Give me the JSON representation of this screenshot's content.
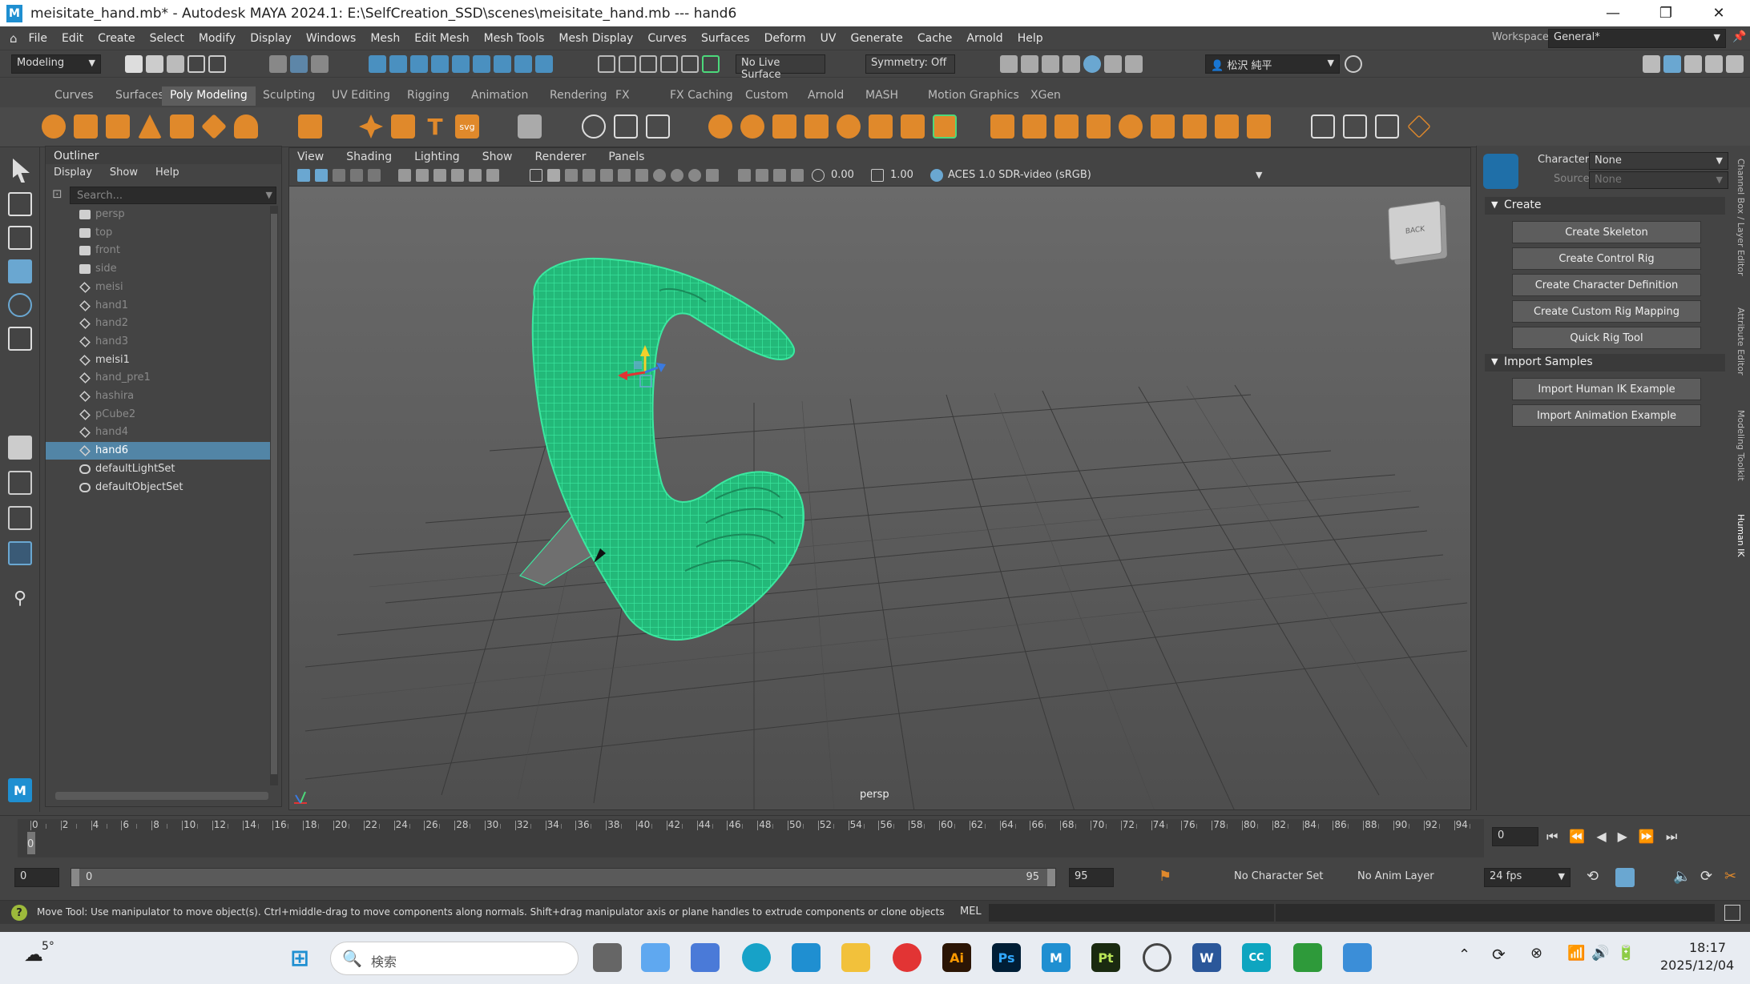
{
  "window": {
    "title": "meisitate_hand.mb* - Autodesk MAYA 2024.1: E:\\SelfCreation_SSD\\scenes\\meisitate_hand.mb   ---   hand6",
    "logo": "M"
  },
  "menus": [
    "File",
    "Edit",
    "Create",
    "Select",
    "Modify",
    "Display",
    "Windows",
    "Mesh",
    "Edit Mesh",
    "Mesh Tools",
    "Mesh Display",
    "Curves",
    "Surfaces",
    "Deform",
    "UV",
    "Generate",
    "Cache",
    "Arnold",
    "Help"
  ],
  "workspace": {
    "label": "Workspace:",
    "value": "General*"
  },
  "status": {
    "mode": "Modeling",
    "live_surface": "No Live Surface",
    "symmetry": "Symmetry: Off",
    "user": "松沢 純平"
  },
  "shelf_tabs": [
    "Curves",
    "Surfaces",
    "Poly Modeling",
    "Sculpting",
    "UV Editing",
    "Rigging",
    "Animation",
    "Rendering",
    "FX",
    "FX Caching",
    "Custom",
    "Arnold",
    "MASH",
    "Motion Graphics",
    "XGen"
  ],
  "shelf_active": "Poly Modeling",
  "outliner": {
    "title": "Outliner",
    "menu": [
      "Display",
      "Show",
      "Help"
    ],
    "search_placeholder": "Search...",
    "items": [
      {
        "name": "persp",
        "type": "camera",
        "dim": true
      },
      {
        "name": "top",
        "type": "camera",
        "dim": true
      },
      {
        "name": "front",
        "type": "camera",
        "dim": true
      },
      {
        "name": "side",
        "type": "camera",
        "dim": true
      },
      {
        "name": "meisi",
        "type": "mesh",
        "dim": true
      },
      {
        "name": "hand1",
        "type": "mesh",
        "dim": true
      },
      {
        "name": "hand2",
        "type": "mesh",
        "dim": true
      },
      {
        "name": "hand3",
        "type": "mesh",
        "dim": true
      },
      {
        "name": "meisi1",
        "type": "mesh",
        "dim": false
      },
      {
        "name": "hand_pre1",
        "type": "mesh",
        "dim": true
      },
      {
        "name": "hashira",
        "type": "mesh",
        "dim": true
      },
      {
        "name": "pCube2",
        "type": "mesh",
        "dim": true
      },
      {
        "name": "hand4",
        "type": "mesh",
        "dim": true
      },
      {
        "name": "hand6",
        "type": "mesh",
        "dim": false,
        "selected": true
      },
      {
        "name": "defaultLightSet",
        "type": "set",
        "dim": false
      },
      {
        "name": "defaultObjectSet",
        "type": "set",
        "dim": false
      }
    ]
  },
  "viewport": {
    "menu": [
      "View",
      "Shading",
      "Lighting",
      "Show",
      "Renderer",
      "Panels"
    ],
    "exposure": "0.00",
    "gamma": "1.00",
    "colorspace": "ACES 1.0 SDR-video (sRGB)",
    "camera_label": "persp",
    "viewcube_label": "BACK",
    "wire_color": "#3be8a0"
  },
  "hik": {
    "character_label": "Character:",
    "character_value": "None",
    "source_label": "Source:",
    "source_value": "None",
    "create_section": "Create",
    "create_buttons": [
      "Create Skeleton",
      "Create Control Rig",
      "Create Character Definition",
      "Create Custom Rig Mapping",
      "Quick Rig Tool"
    ],
    "import_section": "Import Samples",
    "import_buttons": [
      "Import Human IK Example",
      "Import Animation Example"
    ]
  },
  "side_tabs": [
    "Channel Box / Layer Editor",
    "Attribute Editor",
    "Modeling Toolkit",
    "Human IK"
  ],
  "timeline": {
    "ticks": [
      "0",
      "2",
      "4",
      "6",
      "8",
      "10",
      "12",
      "14",
      "16",
      "18",
      "20",
      "22",
      "24",
      "26",
      "28",
      "30",
      "32",
      "34",
      "36",
      "38",
      "40",
      "42",
      "44",
      "46",
      "48",
      "50",
      "52",
      "54",
      "56",
      "58",
      "60",
      "62",
      "64",
      "66",
      "68",
      "70",
      "72",
      "74",
      "76",
      "78",
      "80",
      "82",
      "84",
      "86",
      "88",
      "90",
      "92",
      "94"
    ],
    "current": "0",
    "current_frame_field": "0"
  },
  "range": {
    "start": "0",
    "inner_start": "0",
    "inner_end": "95",
    "end": "95",
    "character_set": "No Character Set",
    "anim_layer": "No Anim Layer",
    "fps": "24 fps"
  },
  "help": {
    "text": "Move Tool: Use manipulator to move object(s). Ctrl+middle-drag to move components along normals. Shift+drag manipulator axis or plane handles to extrude components or clone objects. Ctrl+Shift+drag to constrain moveme",
    "mel_label": "MEL"
  },
  "taskbar": {
    "weather": "5°",
    "search_placeholder": "検索",
    "time": "18:17",
    "date": "2025/12/04"
  }
}
